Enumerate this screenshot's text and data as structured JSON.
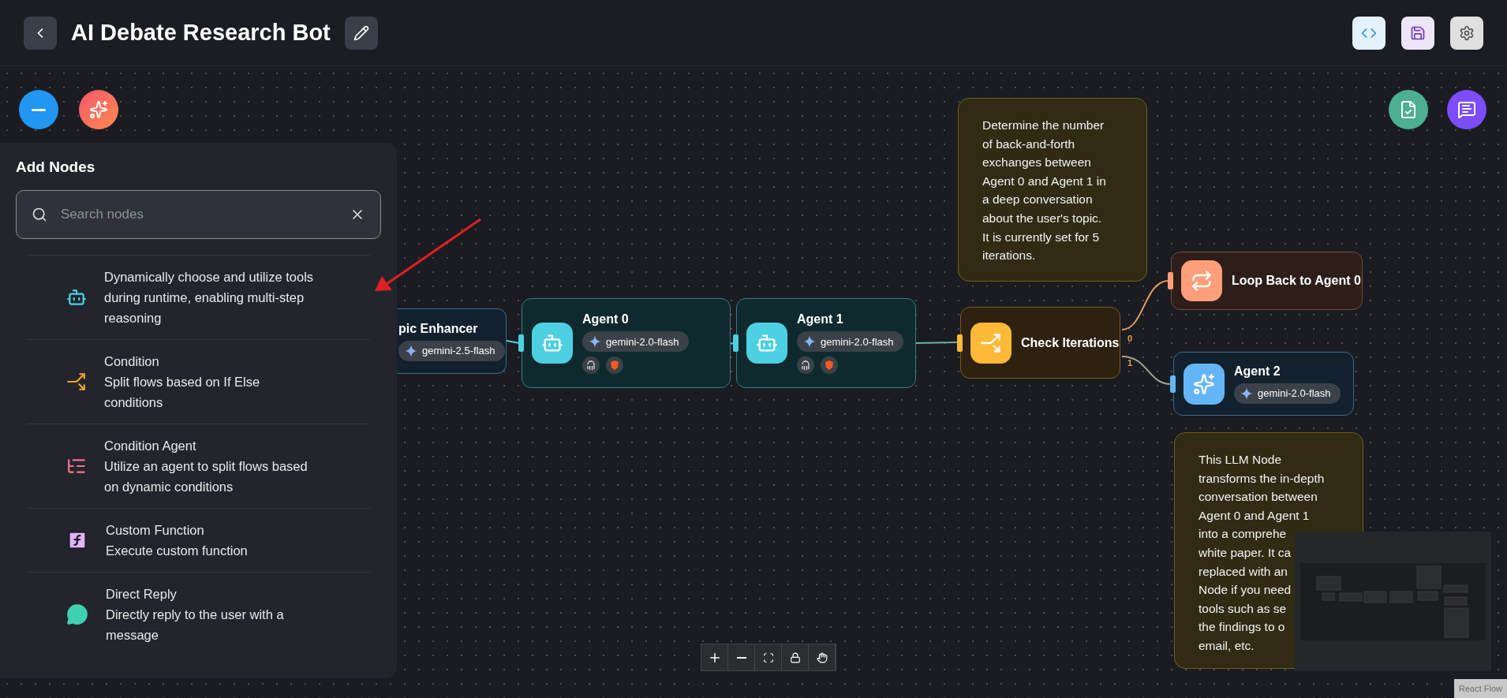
{
  "header": {
    "title": "AI Debate Research Bot"
  },
  "add_nodes_panel": {
    "title": "Add Nodes",
    "search": {
      "placeholder": "Search nodes"
    },
    "items": [
      {
        "kind": "agent",
        "description": "Dynamically choose and utilize tools during runtime, enabling multi-step reasoning"
      },
      {
        "kind": "condition",
        "name": "Condition",
        "description": "Split flows based on If Else conditions"
      },
      {
        "kind": "condition_agent",
        "name": "Condition Agent",
        "description": "Utilize an agent to split flows based on dynamic conditions"
      },
      {
        "kind": "function",
        "name": "Custom Function",
        "description": "Execute custom function"
      },
      {
        "kind": "reply",
        "name": "Direct Reply",
        "description": "Directly reply to the user with a message"
      }
    ]
  },
  "canvas": {
    "nodes": [
      {
        "kind": "llm",
        "label": "pic Enhancer",
        "model": "gemini-2.5-flash"
      },
      {
        "kind": "agent",
        "label": "Agent 0",
        "model": "gemini-2.0-flash"
      },
      {
        "kind": "agent",
        "label": "Agent 1",
        "model": "gemini-2.0-flash"
      },
      {
        "kind": "condition",
        "label": "Check Iterations"
      },
      {
        "kind": "loop",
        "label": "Loop Back to Agent 0"
      },
      {
        "kind": "llm_main",
        "label": "Agent 2",
        "model": "gemini-2.0-flash"
      }
    ],
    "edge_labels": [
      "0",
      "1"
    ],
    "notes": [
      {
        "lines": [
          "Determine the number",
          "of back-and-forth",
          "exchanges between",
          "Agent 0 and Agent 1 in",
          "a deep conversation",
          "about the user's topic.",
          "It is currently set for 5",
          "iterations."
        ]
      },
      {
        "lines": [
          "This LLM Node",
          "transforms the in-depth",
          "conversation between",
          "Agent 0 and Agent 1",
          "into a comprehe",
          "white paper. It ca",
          "replaced with an",
          "Node if you need",
          "tools such as se",
          "the findings to o",
          "email, etc."
        ]
      }
    ]
  },
  "attribution": "React Flow"
}
